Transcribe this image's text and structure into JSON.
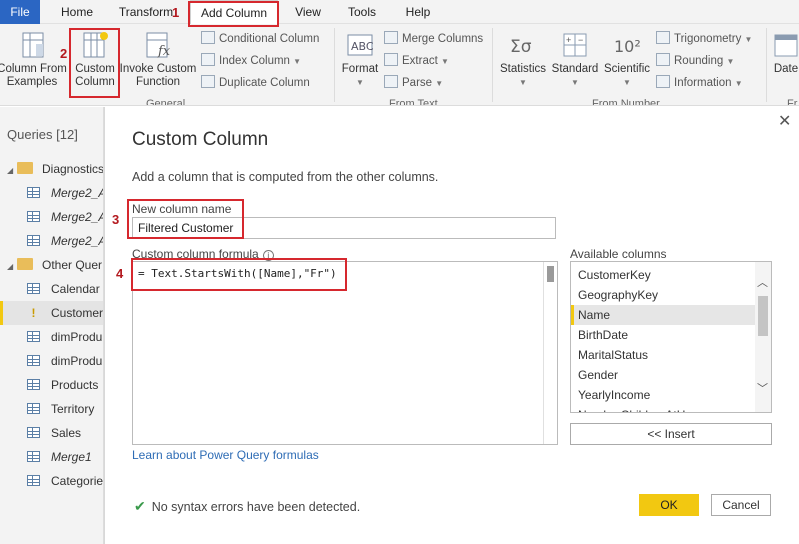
{
  "tabs": {
    "file": "File",
    "home": "Home",
    "transform": "Transform",
    "add_column": "Add Column",
    "view": "View",
    "tools": "Tools",
    "help": "Help"
  },
  "ribbon": {
    "column_from_examples": [
      "Column From",
      "Examples"
    ],
    "custom_column": [
      "Custom",
      "Column"
    ],
    "invoke_custom_function": [
      "Invoke Custom",
      "Function"
    ],
    "conditional_column": "Conditional Column",
    "index_column": "Index Column",
    "duplicate_column": "Duplicate Column",
    "group_general": "General",
    "format": "Format",
    "merge_columns": "Merge Columns",
    "extract": "Extract",
    "parse": "Parse",
    "group_from_text": "From Text",
    "statistics": "Statistics",
    "standard": "Standard",
    "scientific": "Scientific",
    "scientific_glyph": "10²",
    "trigonometry": "Trigonometry",
    "rounding": "Rounding",
    "information": "Information",
    "group_from_number": "From Number",
    "date": "Date",
    "group_partial": "Fr"
  },
  "queries": {
    "title": "Queries [12]",
    "items": [
      {
        "label": "Diagnostics",
        "type": "folder"
      },
      {
        "label": "Merge2_A",
        "type": "table",
        "italic": true
      },
      {
        "label": "Merge2_A",
        "type": "table",
        "italic": true
      },
      {
        "label": "Merge2_A",
        "type": "table",
        "italic": true
      },
      {
        "label": "Other Quer",
        "type": "folder"
      },
      {
        "label": "Calendar",
        "type": "table"
      },
      {
        "label": "Customer",
        "type": "warning",
        "selected": true
      },
      {
        "label": "dimProdu",
        "type": "table"
      },
      {
        "label": "dimProdu",
        "type": "table"
      },
      {
        "label": "Products",
        "type": "table"
      },
      {
        "label": "Territory",
        "type": "table"
      },
      {
        "label": "Sales",
        "type": "table"
      },
      {
        "label": "Merge1",
        "type": "table",
        "italic": true
      },
      {
        "label": "Categorie",
        "type": "table"
      }
    ]
  },
  "dialog": {
    "title": "Custom Column",
    "description": "Add a column that is computed from the other columns.",
    "name_label": "New column name",
    "name_value": "Filtered Customer",
    "formula_label": "Custom column formula",
    "formula_value": "= Text.StartsWith([Name],\"Fr\")",
    "available_label": "Available columns",
    "available_columns": [
      "CustomerKey",
      "GeographyKey",
      "Name",
      "BirthDate",
      "MaritalStatus",
      "Gender",
      "YearlyIncome",
      "NumberChildrenAtH"
    ],
    "selected_column": "Name",
    "insert_button": "<< Insert",
    "learn_link": "Learn about Power Query formulas",
    "status": "No syntax errors have been detected.",
    "ok_button": "OK",
    "cancel_button": "Cancel"
  },
  "annotations": [
    "1",
    "2",
    "3",
    "4"
  ],
  "colors": {
    "accent": "#f2c811",
    "file_tab": "#2b66c3",
    "annotation": "#d6282e",
    "link": "#2e6cb5"
  }
}
